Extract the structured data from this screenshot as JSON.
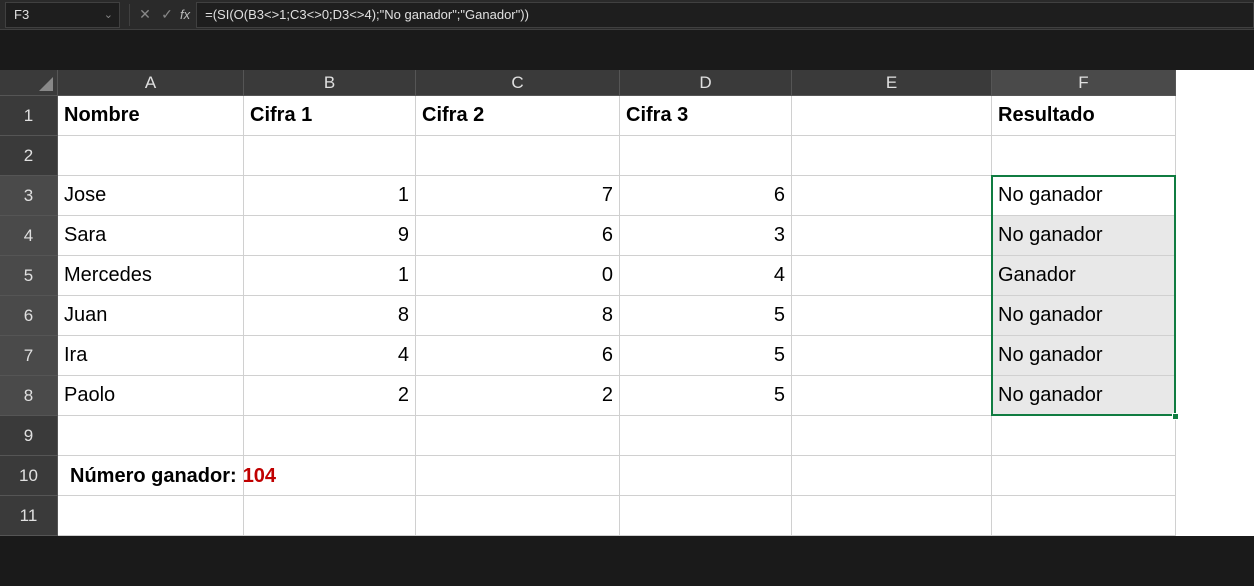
{
  "nameBox": "F3",
  "formula": "=(SI(O(B3<>1;C3<>0;D3<>4);\"No ganador\";\"Ganador\"))",
  "columns": [
    "A",
    "B",
    "C",
    "D",
    "E",
    "F"
  ],
  "headers": {
    "A": "Nombre",
    "B": "Cifra 1",
    "C": "Cifra 2",
    "D": "Cifra 3",
    "F": "Resultado"
  },
  "rows": [
    {
      "r": 3,
      "A": "Jose",
      "B": "1",
      "C": "7",
      "D": "6",
      "F": "No ganador"
    },
    {
      "r": 4,
      "A": "Sara",
      "B": "9",
      "C": "6",
      "D": "3",
      "F": "No ganador"
    },
    {
      "r": 5,
      "A": "Mercedes",
      "B": "1",
      "C": "0",
      "D": "4",
      "F": "Ganador"
    },
    {
      "r": 6,
      "A": "Juan",
      "B": "8",
      "C": "8",
      "D": "5",
      "F": "No ganador"
    },
    {
      "r": 7,
      "A": "Ira",
      "B": "4",
      "C": "6",
      "D": "5",
      "F": "No ganador"
    },
    {
      "r": 8,
      "A": "Paolo",
      "B": "2",
      "C": "2",
      "D": "5",
      "F": "No ganador"
    }
  ],
  "footer": {
    "label": "Número ganador:",
    "value": "104"
  }
}
